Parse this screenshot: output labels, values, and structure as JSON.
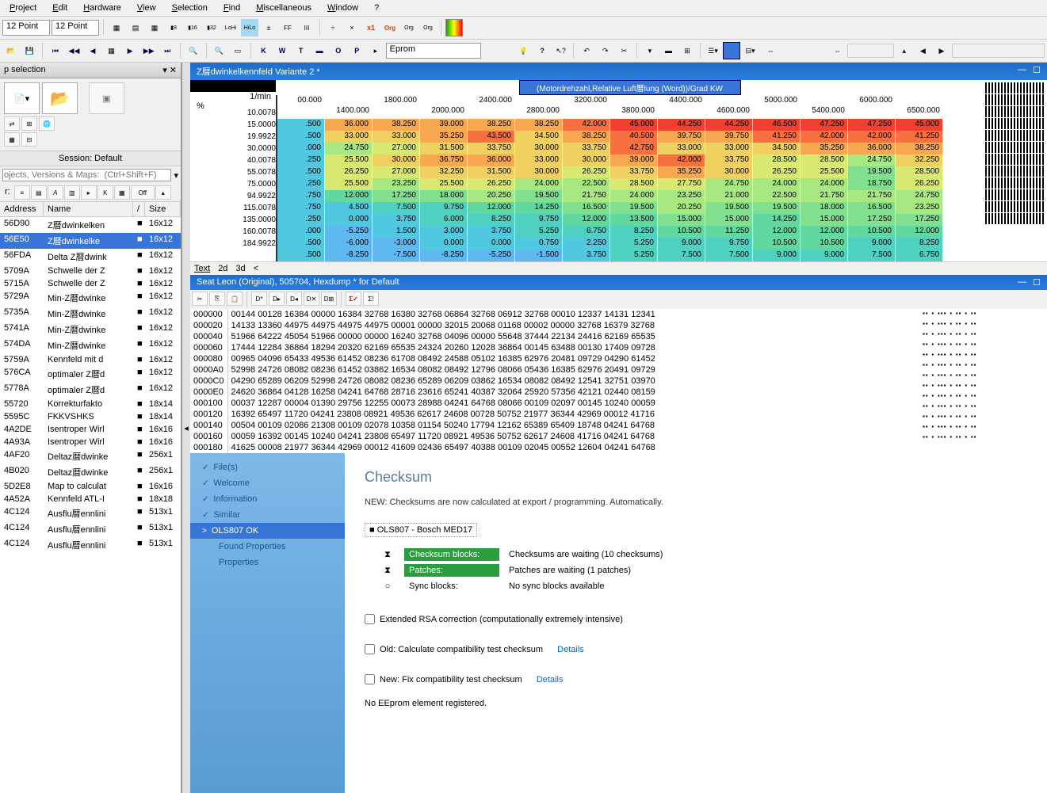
{
  "menu": {
    "items": [
      "Project",
      "Edit",
      "Hardware",
      "View",
      "Selection",
      "Find",
      "Miscellaneous",
      "Window",
      "?"
    ]
  },
  "toolbar1": {
    "combo1": "12 Point",
    "combo2": "12 Point"
  },
  "toolbar2": {
    "eprom": "Eprom"
  },
  "left": {
    "title": "p selection",
    "session": "Session: Default",
    "search_placeholder": "ojects, Versions & Maps:  (Ctrl+Shift+F)",
    "filter_label": "r:",
    "off_btn": "Off",
    "headers": {
      "addr": "Address",
      "name": "Name",
      "i": "/",
      "size": "Size"
    },
    "maps": [
      {
        "a": "56D90",
        "n": "Z暦dwinkelken",
        "s": "16x12",
        "sel": false
      },
      {
        "a": "56E50",
        "n": "Z暦dwinkelke",
        "s": "16x12",
        "sel": true
      },
      {
        "a": "56FDA",
        "n": "Delta Z暦dwink",
        "s": "16x12"
      },
      {
        "a": "5709A",
        "n": "Schwelle der Z",
        "s": "16x12"
      },
      {
        "a": "5715A",
        "n": "Schwelle der Z",
        "s": "16x12"
      },
      {
        "a": "5729A",
        "n": "Min-Z暦dwinke",
        "s": "16x12"
      },
      {
        "a": "5735A",
        "n": "Min-Z暦dwinke",
        "s": "16x12"
      },
      {
        "a": "5741A",
        "n": "Min-Z暦dwinke",
        "s": "16x12"
      },
      {
        "a": "574DA",
        "n": "Min-Z暦dwinke",
        "s": "16x12"
      },
      {
        "a": "5759A",
        "n": "Kennfeld mit d",
        "s": "16x12"
      },
      {
        "a": "576CA",
        "n": "optimaler Z暦d",
        "s": "16x12"
      },
      {
        "a": "5778A",
        "n": "optimaler Z暦d",
        "s": "16x12"
      },
      {
        "a": "55720",
        "n": "Korrekturfakto",
        "s": "18x14"
      },
      {
        "a": "5595C",
        "n": "FKKVSHKS",
        "s": "18x14"
      },
      {
        "a": "4A2DE",
        "n": "Isentroper Wirl",
        "s": "16x16"
      },
      {
        "a": "4A93A",
        "n": "Isentroper Wirl",
        "s": "16x16"
      },
      {
        "a": "4AF20",
        "n": "Deltaz暦dwinke",
        "s": "256x1"
      },
      {
        "a": "4B020",
        "n": "Deltaz暦dwinke",
        "s": "256x1"
      },
      {
        "a": "5D2E8",
        "n": "Map to calculat",
        "s": "16x16"
      },
      {
        "a": "4A52A",
        "n": "Kennfeld ATL-I",
        "s": "18x18"
      },
      {
        "a": "4C124",
        "n": "Ausflu暦ennlini",
        "s": "513x1"
      },
      {
        "a": "4C124",
        "n": "Ausflu暦ennlini",
        "s": "513x1"
      },
      {
        "a": "4C124",
        "n": "Ausflu暦ennlini",
        "s": "513x1"
      }
    ]
  },
  "mapdoc": {
    "title": "Z暦dwinkelkennfeld Variante 2 *",
    "axis_label": "(Motordrehzahl,Relative Luft暦lung (Word))/Grad KW",
    "unit": "1/min",
    "pct": "%",
    "x_top": [
      "00.000",
      "",
      "1800.000",
      "",
      "2400.000",
      "",
      "3200.000",
      "",
      "4400.000",
      "",
      "5000.000",
      "",
      "6000.000",
      ""
    ],
    "x_bot": [
      "",
      "1400.000",
      "",
      "2000.000",
      "",
      "2800.000",
      "",
      "3800.000",
      "",
      "4600.000",
      "",
      "5400.000",
      "",
      "6500.000"
    ],
    "y": [
      "10.0078",
      "15.0000",
      "19.9922",
      "30.0000",
      "40.0078",
      "55.0078",
      "75.0000",
      "94.9922",
      "115.0078",
      "135.0000",
      "160.0078",
      "184.9922"
    ],
    "cells": [
      [
        ".500",
        "36.000",
        "38.250",
        "39.000",
        "38.250",
        "38.250",
        "42.000",
        "45.000",
        "44.250",
        "44.250",
        "46.500",
        "47.250",
        "47.250",
        "45.000"
      ],
      [
        ".500",
        "33.000",
        "33.000",
        "35.250",
        "43.500",
        "34.500",
        "38.250",
        "40.500",
        "39.750",
        "39.750",
        "41.250",
        "42.000",
        "42.000",
        "41.250"
      ],
      [
        ".000",
        "24.750",
        "27.000",
        "31.500",
        "33.750",
        "30.000",
        "33.750",
        "42.750",
        "33.000",
        "33.000",
        "34.500",
        "35.250",
        "36.000",
        "38.250"
      ],
      [
        ".250",
        "25.500",
        "30.000",
        "36.750",
        "36.000",
        "33.000",
        "30.000",
        "39.000",
        "42.000",
        "33.750",
        "28.500",
        "28.500",
        "24.750",
        "32.250"
      ],
      [
        ".500",
        "26.250",
        "27.000",
        "32.250",
        "31.500",
        "30.000",
        "26.250",
        "33.750",
        "35.250",
        "30.000",
        "26.250",
        "25.500",
        "19.500",
        "28.500"
      ],
      [
        ".250",
        "25.500",
        "23.250",
        "25.500",
        "26.250",
        "24.000",
        "22.500",
        "28.500",
        "27.750",
        "24.750",
        "24.000",
        "24.000",
        "18.750",
        "26.250"
      ],
      [
        ".750",
        "12.000",
        "17.250",
        "18.000",
        "20.250",
        "19.500",
        "21.750",
        "24.000",
        "23.250",
        "21.000",
        "22.500",
        "21.750",
        "21.750",
        "24.750"
      ],
      [
        ".750",
        "4.500",
        "7.500",
        "9.750",
        "12.000",
        "14.250",
        "16.500",
        "19.500",
        "20.250",
        "19.500",
        "19.500",
        "18.000",
        "16.500",
        "23.250"
      ],
      [
        ".250",
        "0.000",
        "3.750",
        "6.000",
        "8.250",
        "9.750",
        "12.000",
        "13.500",
        "15.000",
        "15.000",
        "14.250",
        "15.000",
        "17.250",
        "17.250"
      ],
      [
        ".000",
        "-5.250",
        "1.500",
        "3.000",
        "3.750",
        "5.250",
        "6.750",
        "8.250",
        "10.500",
        "11.250",
        "12.000",
        "12.000",
        "10.500",
        "12.000"
      ],
      [
        ".500",
        "-6.000",
        "-3.000",
        "0.000",
        "0.000",
        "0.750",
        "2.250",
        "5.250",
        "9.000",
        "9.750",
        "10.500",
        "10.500",
        "9.000",
        "8.250"
      ],
      [
        ".500",
        "-8.250",
        "-7.500",
        "-8.250",
        "-5.250",
        "-1.500",
        "3.750",
        "5.250",
        "7.500",
        "7.500",
        "9.000",
        "9.000",
        "7.500",
        "6.750"
      ]
    ],
    "tabs": [
      "Text",
      "2d",
      "3d",
      "<"
    ]
  },
  "hexdoc": {
    "title": "Seat Leon (Original), 505704, Hexdump * for Default",
    "addrs": [
      "000000",
      "000020",
      "000040",
      "000060",
      "000080",
      "0000A0",
      "0000C0",
      "0000E0",
      "000100",
      "000120",
      "000140",
      "000160",
      "000180"
    ],
    "rows": [
      "00144 00128 16384 00000 16384 32768 16380 32768 06864 32768 06912 32768 00010 12337 14131 12341",
      "14133 13360 44975 44975 44975 44975 00001 00000 32015 20068 01168 00002 00000 32768 16379 32768",
      "51966 64222 45054 51966 00000 00000 16240 32768 04096 00000 55648 37444 22134 24416 62169 65535",
      "17444 12284 36864 18294 20320 62169 65535 24324 20260 12028 36864 00145 63488 00130 17409 09728",
      "00965 04096 65433 49536 61452 08236 61708 08492 24588 05102 16385 62976 20481 09729 04290 61452",
      "52998 24726 08082 08236 61452 03862 16534 08082 08492 12796 08066 05436 16385 62976 20491 09729",
      "04290 65289 06209 52998 24726 08082 08236 65289 06209 03862 16534 08082 08492 12541 32751 03970",
      "24620 36864 04128 16258 04241 64768 28716 23616 65241 40387 32064 25920 57356 42121 02440 08159",
      "00037 12287 00004 01390 29756 12255 00073 28988 04241 64768 08066 00109 02097 00145 10240 00059",
      "16392 65497 11720 04241 23808 08921 49536 62617 24608 00728 50752 21977 36344 42969 00012 41716",
      "00504 00109 02086 21308 00109 02078 10358 01154 50240 17794 12162 65389 65409 18748 04241 64768",
      "00059 16392 00145 10240 04241 23808 65497 11720 08921 49536 50752 62617 24608 41716 04241 64768",
      "41625 00008 21977 36344 42969 00012 41609 02436 65497 40388 00109 02045 00552 12604 04241 64768"
    ]
  },
  "nav": {
    "items": [
      {
        "t": "File(s)"
      },
      {
        "t": "Welcome"
      },
      {
        "t": "Information"
      },
      {
        "t": "Similar"
      },
      {
        "t": "OLS807 OK",
        "sel": true
      },
      {
        "t": "Found Properties",
        "sub": true
      },
      {
        "t": "Properties",
        "sub": true
      }
    ]
  },
  "checksum": {
    "title": "Checksum",
    "info": "NEW:  Checksums are now calculated at export / programming. Automatically.",
    "device": "OLS807 - Bosch MED17",
    "rows": [
      {
        "ico": "⧗",
        "lbl": "Checksum blocks:",
        "g": true,
        "txt": "Checksums are waiting (10 checksums)"
      },
      {
        "ico": "⧗",
        "lbl": "Patches:",
        "g": true,
        "txt": "Patches are waiting (1 patches)"
      },
      {
        "ico": "○",
        "lbl": "Sync blocks:",
        "g": false,
        "txt": "No sync blocks available"
      }
    ],
    "chk1": "Extended RSA correction (computationally extremely intensive)",
    "chk2": "Old: Calculate compatibility test checksum",
    "chk3": "New: Fix compatibility test checksum",
    "details": "Details",
    "eeprom": "No EEprom element registered."
  }
}
